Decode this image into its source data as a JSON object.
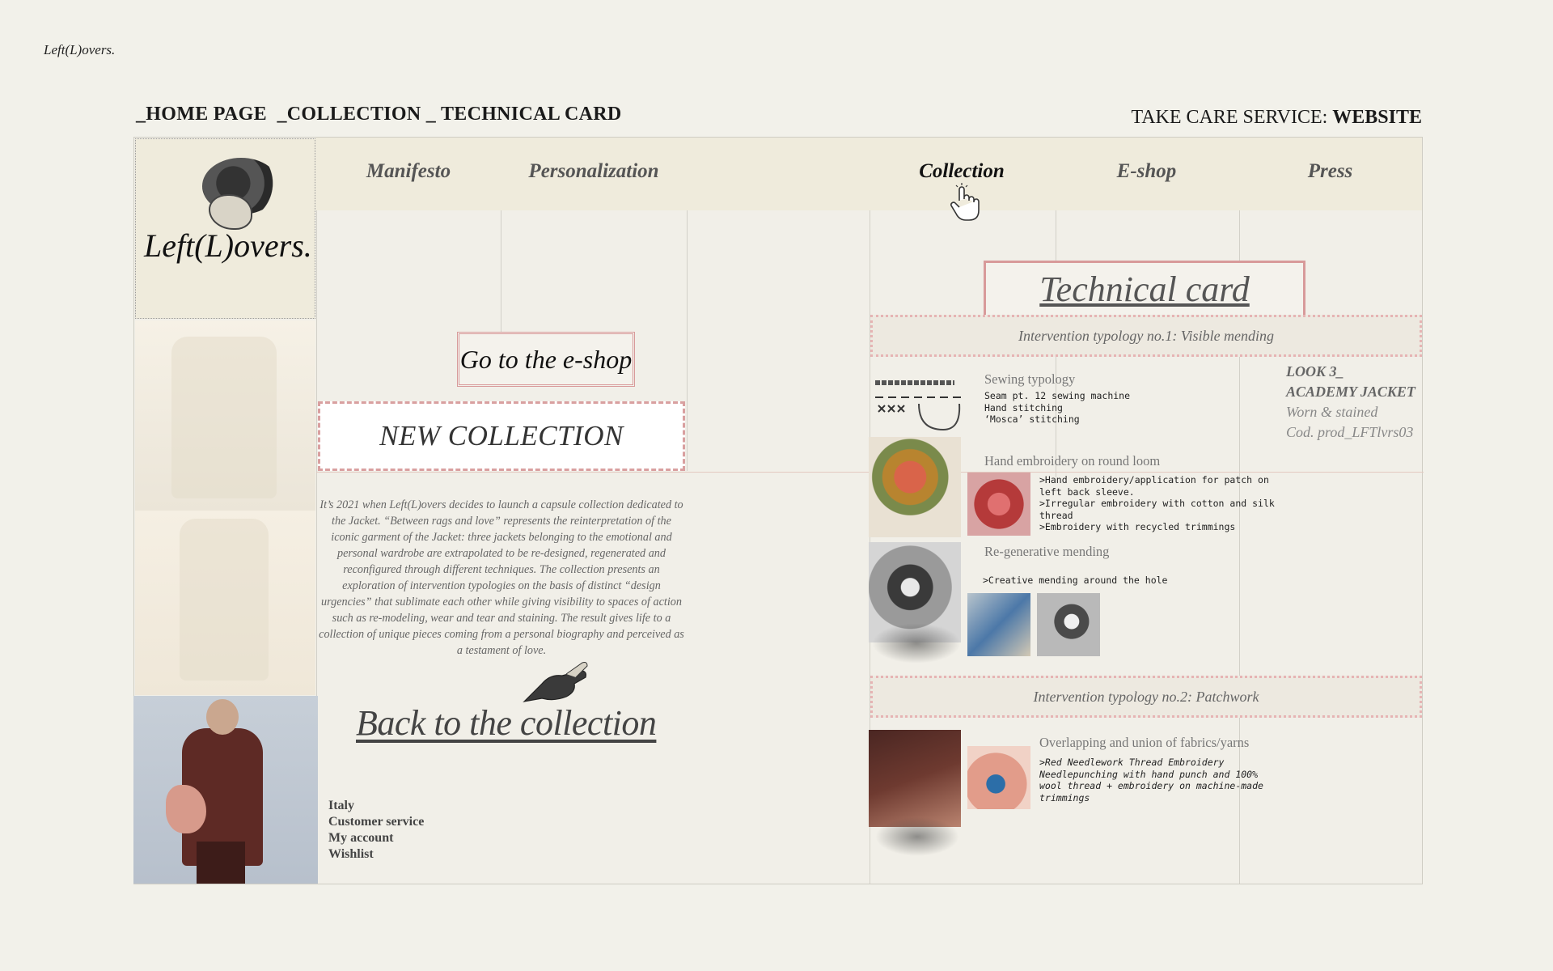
{
  "brand": {
    "name": "Left(L)overs.",
    "logo_text": "Left(L)overs."
  },
  "breadcrumb": "_HOME PAGE  _COLLECTION _ TECHNICAL CARD",
  "service": {
    "label": "TAKE CARE SERVICE: ",
    "value": "WEBSITE"
  },
  "nav": {
    "items": [
      {
        "label": "Manifesto"
      },
      {
        "label": "Personalization"
      },
      {
        "label": "Collection",
        "active": true
      },
      {
        "label": "E-shop"
      },
      {
        "label": "Press"
      }
    ]
  },
  "left": {
    "eshop_button": "Go to the e-shop",
    "new_collection_button": "NEW COLLECTION",
    "body_text": "It’s 2021 when Left(L)overs decides to launch a capsule collection dedicated to the Jacket. “Between rags and love” represents the reinterpretation of the iconic garment of the Jacket: three jackets belonging to the emotional and personal wardrobe are extrapolated to be re-designed, regenerated and reconfigured through different techniques. The collection presents an exploration of intervention typologies on the basis of distinct “design urgencies” that sublimate each other while giving visibility to spaces of action such as re-modeling, wear and tear and staining. The result gives life to a collection of unique pieces coming from a personal biography and perceived as a testament of love.",
    "back_link": "Back to the collection",
    "footer": [
      "Italy",
      "Customer service",
      "My account",
      "Wishlist"
    ]
  },
  "technical": {
    "title": "Technical card",
    "typology1": "Intervention typology no.1: Visible mending",
    "sewing": {
      "title": "Sewing typology",
      "lines": "Seam pt. 12 sewing machine\nHand stitching\n‘Mosca’ stitching"
    },
    "look": {
      "line1": "LOOK 3_",
      "line2": "ACADEMY JACKET",
      "line3": "Worn & stained",
      "line4": "Cod. prod_LFTlvrs03"
    },
    "embroidery": {
      "title": "Hand embroidery on round loom",
      "lines": ">Hand embroidery/application for patch on\nleft back sleeve.\n>Irregular embroidery with cotton and silk\nthread\n>Embroidery with recycled trimmings"
    },
    "regenerative": {
      "title": "Re-generative mending",
      "lines": ">Creative mending around the hole"
    },
    "typology2": "Intervention typology no.2: Patchwork",
    "overlap": {
      "title": "Overlapping and union of fabrics/yarns",
      "lines": ">Red Needlework Thread Embroidery\nNeedlepunching with hand punch and 100%\nwool thread + embroidery on machine-made\ntrimmings"
    }
  },
  "colors": {
    "background": "#f2f1ea",
    "nav_bg": "#efebdc",
    "accent_pink": "#d89a9a"
  },
  "icons": [
    "hand-cursor-icon",
    "pointing-hand-icon"
  ]
}
